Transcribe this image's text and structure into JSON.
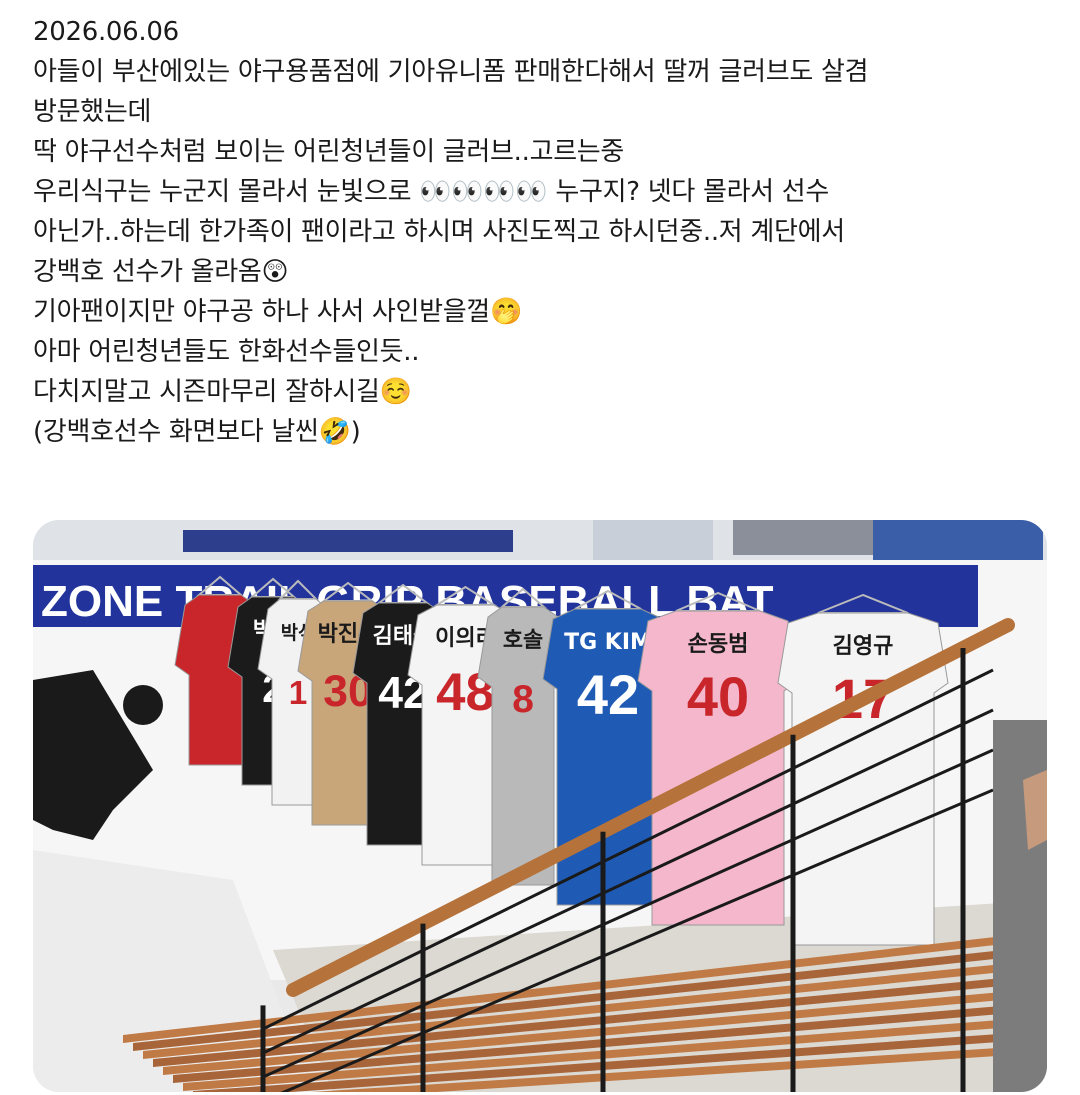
{
  "post": {
    "date": "2026.06.06",
    "lines": [
      "아들이 부산에있는 야구용품점에 기아유니폼 판매한다해서 딸꺼 글러브도 살겸",
      "방문했는데",
      "딱 야구선수처럼 보이는 어린청년들이 글러브..고르는중",
      "우리식구는 누군지 몰라서 눈빛으로 👀👀👀👀 누구지? 넷다 몰라서 선수",
      "아닌가..하는데 한가족이 팬이라고 하시며 사진도찍고 하시던중..저 계단에서",
      "강백호 선수가 올라옴😲",
      "기아팬이지만 야구공 하나 사서 사인받을껄🤭",
      "아마 어린청년들도 한화선수들인듯..",
      "다치지말고 시즌마무리 잘하시길☺️",
      "(강백호선수 화면보다 날씬🤣)"
    ]
  },
  "photo": {
    "banner_text": "ZONE  TRAIL  GRIP  BASEBALL  BAT",
    "jerseys": [
      {
        "name": "",
        "number": "",
        "color": "#c8262b"
      },
      {
        "name": "박민",
        "number": "2",
        "color": "#1b1b1b"
      },
      {
        "name": "박석",
        "number": "1",
        "color": "#f2f2f2"
      },
      {
        "name": "박진우",
        "number": "30",
        "color": "#c9a67a"
      },
      {
        "name": "김태군",
        "number": "42",
        "color": "#1b1b1b"
      },
      {
        "name": "이의리",
        "number": "48",
        "color": "#f4f4f4"
      },
      {
        "name": "호솔",
        "number": "8",
        "color": "#b9b9b9"
      },
      {
        "name": "TG KIM",
        "number": "42",
        "color": "#1f5bb5"
      },
      {
        "name": "손동범",
        "number": "40",
        "color": "#f4b7cc"
      },
      {
        "name": "김영규",
        "number": "17",
        "color": "#f4f4f4"
      }
    ]
  }
}
